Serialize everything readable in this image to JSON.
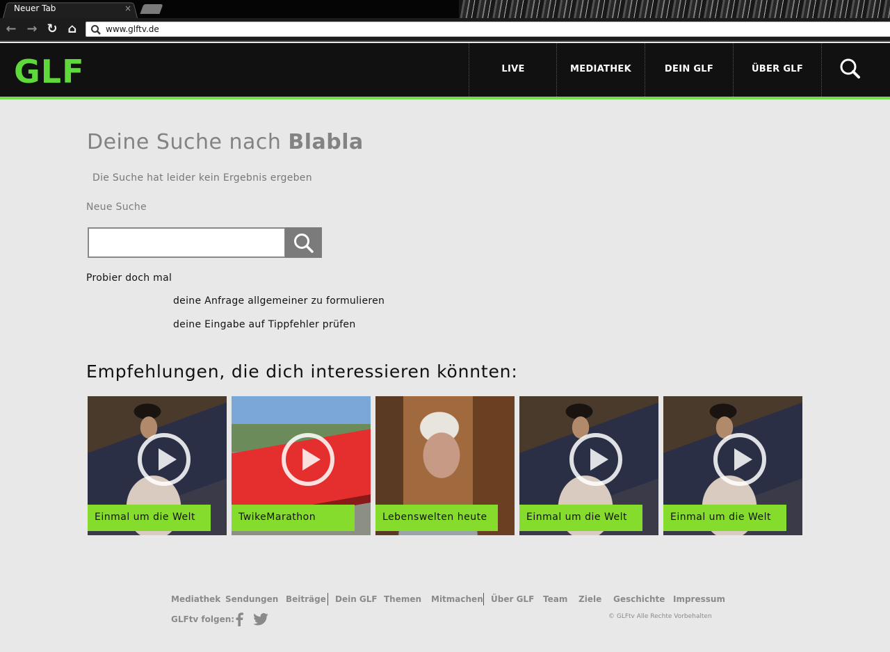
{
  "browser": {
    "tab_title": "Neuer Tab",
    "tab_close": "×",
    "url": "www.glftv.de"
  },
  "site": {
    "logo": "GLF",
    "nav": [
      "LIVE",
      "MEDIATHEK",
      "DEIN GLF",
      "ÜBER GLF"
    ]
  },
  "main": {
    "heading_prefix": "Deine Suche nach ",
    "query": "Blabla",
    "no_result": "Die Suche hat leider kein Ergebnis ergeben",
    "new_search_label": "Neue Suche",
    "search_value": "",
    "try_label": "Probier doch mal",
    "tips": [
      "deine Anfrage allgemeiner zu formulieren",
      "deine Eingabe auf Tippfehler prüfen"
    ],
    "reco_title": "Empfehlungen, die dich interessieren könnten:"
  },
  "recommendations": [
    {
      "label": "Einmal um die Welt",
      "image": "man-portrait",
      "play": true
    },
    {
      "label": "TwikeMarathon",
      "image": "red-vehicle",
      "play": true
    },
    {
      "label": "Lebenswelten heute",
      "image": "elderly-man",
      "play": false
    },
    {
      "label": "Einmal um die Welt",
      "image": "man-portrait",
      "play": true
    },
    {
      "label": "Einmal um die Welt",
      "image": "man-portrait",
      "play": true
    }
  ],
  "footer": {
    "links": [
      "Mediathek",
      "Sendungen",
      "Beiträge",
      "Dein GLF",
      "Themen",
      "Mitmachen",
      "Über GLF",
      "Team",
      "Ziele",
      "Geschichte",
      "Impressum"
    ],
    "follow": "GLFtv folgen:",
    "copyright": "© GLFtv Alle Rechte Vorbehalten"
  },
  "colors": {
    "accent": "#72dd4e",
    "label_bg": "#86dc2c",
    "header_bg": "#111111"
  }
}
